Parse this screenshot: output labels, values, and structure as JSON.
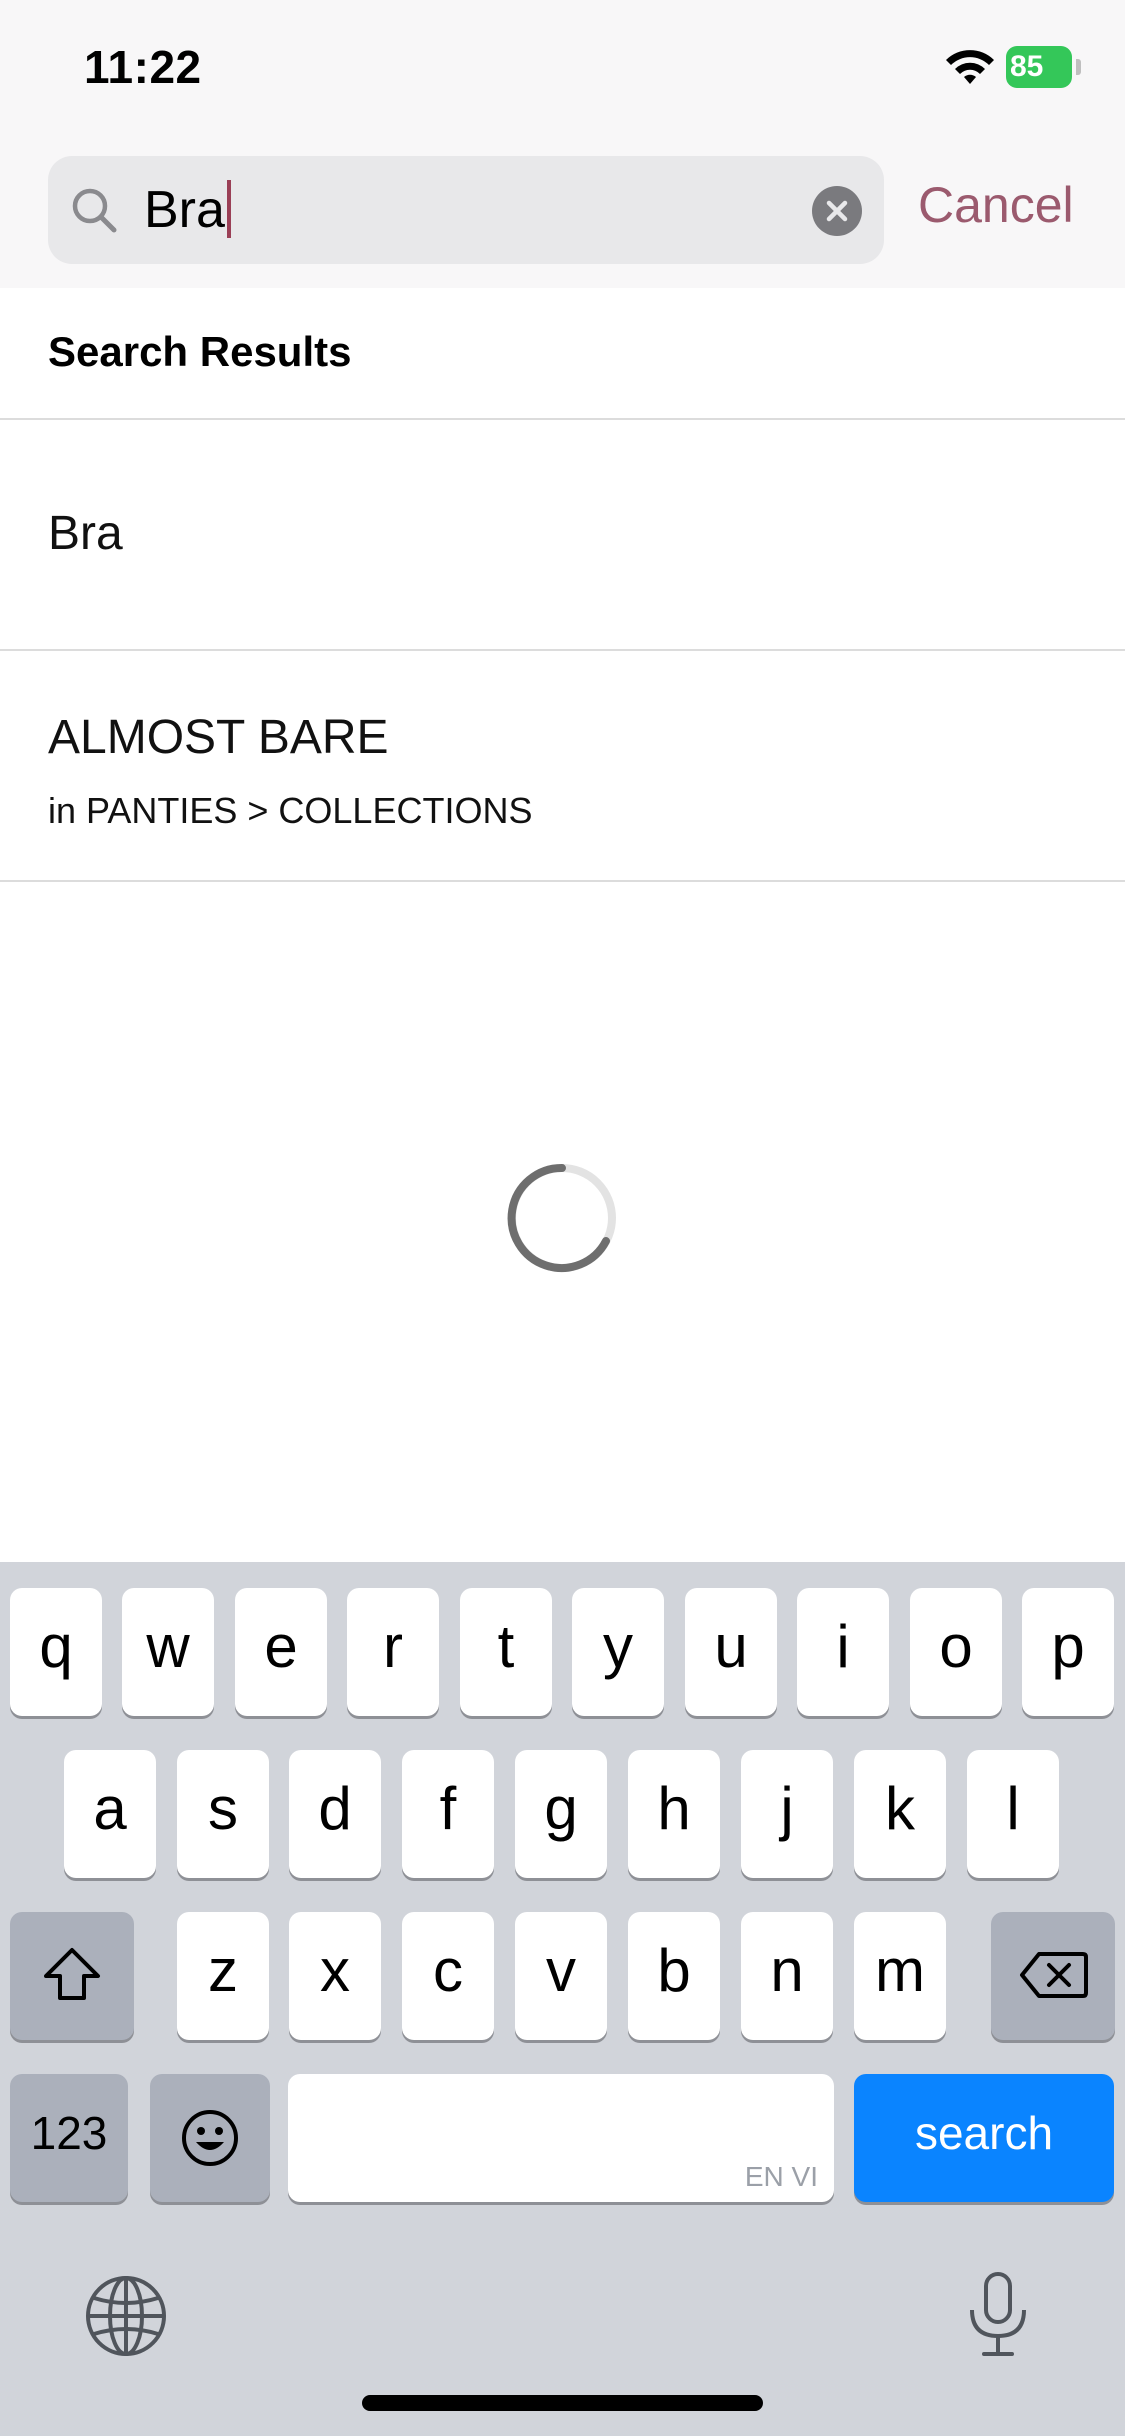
{
  "status_bar": {
    "time": "11:22",
    "battery": "85"
  },
  "search": {
    "query": "Bra",
    "cancel_label": "Cancel"
  },
  "results": {
    "title": "Search Results",
    "items": [
      {
        "title": "Bra"
      },
      {
        "title": "ALMOST BARE",
        "subtitle": "in PANTIES > COLLECTIONS"
      }
    ]
  },
  "keyboard": {
    "row1": [
      "q",
      "w",
      "e",
      "r",
      "t",
      "y",
      "u",
      "i",
      "o",
      "p"
    ],
    "row2": [
      "a",
      "s",
      "d",
      "f",
      "g",
      "h",
      "j",
      "k",
      "l"
    ],
    "row3": [
      "z",
      "x",
      "c",
      "v",
      "b",
      "n",
      "m"
    ],
    "numbers_label": "123",
    "search_label": "search",
    "space_language": "EN VI"
  },
  "colors": {
    "accent": "#9b5a6e",
    "search_key": "#0a84ff",
    "battery": "#34c759"
  }
}
